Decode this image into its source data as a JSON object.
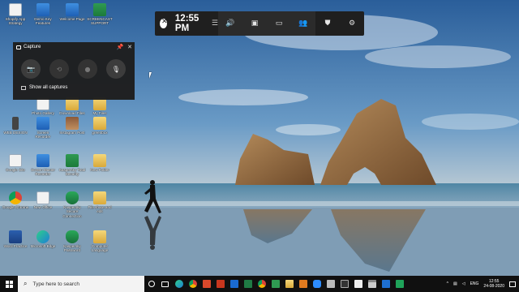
{
  "desktop": {
    "icons": [
      {
        "label": "Shopify App Strategy",
        "glyph": "g-doc"
      },
      {
        "label": "Demo Key Features",
        "glyph": "g-blue"
      },
      {
        "label": "Welcome Page",
        "glyph": "g-blue"
      },
      {
        "label": "SCREENCAST SUPPORT",
        "glyph": "g-green"
      },
      {
        "label": "Photo Gallery",
        "glyph": "g-doc"
      },
      {
        "label": "Download Files",
        "glyph": "g-folder"
      },
      {
        "label": "My Files",
        "glyph": "g-folder"
      },
      {
        "label": "WEB DESIGN",
        "glyph": "g-phone"
      },
      {
        "label": "Screen Recorder",
        "glyph": "g-blue"
      },
      {
        "label": "Instagram Post",
        "glyph": "g-photo"
      },
      {
        "label": "greenbox",
        "glyph": "g-folder"
      },
      {
        "label": "Google Site",
        "glyph": "g-doc"
      },
      {
        "label": "Screen Master Recorder",
        "glyph": "g-blue"
      },
      {
        "label": "Kaspersky Total Security",
        "glyph": "g-green"
      },
      {
        "label": "New Folder",
        "glyph": "g-folder"
      },
      {
        "label": "Google Chrome",
        "glyph": "g-chrome"
      },
      {
        "label": "New Office",
        "glyph": "g-doc"
      },
      {
        "label": "Kaspersky Secure Connection",
        "glyph": "g-shield"
      },
      {
        "label": "File share and edit",
        "glyph": "g-folder"
      },
      {
        "label": "Word Practice",
        "glyph": "g-word"
      },
      {
        "label": "Microsoft Edge",
        "glyph": "g-edge"
      },
      {
        "label": "Kaspersky Password",
        "glyph": "g-shield"
      },
      {
        "label": "Computer Language",
        "glyph": "g-folder"
      }
    ]
  },
  "gamebar": {
    "time": "12:55 PM",
    "buttons": [
      {
        "name": "audio",
        "glyph": "🔊"
      },
      {
        "name": "capture",
        "glyph": "▣"
      },
      {
        "name": "performance",
        "glyph": "▭"
      },
      {
        "name": "social",
        "glyph": "👥"
      }
    ],
    "right_buttons": [
      {
        "name": "shield",
        "glyph": "⛊"
      },
      {
        "name": "settings",
        "glyph": "⚙"
      }
    ]
  },
  "capture": {
    "title": "Capture",
    "show_all": "Show all captures"
  },
  "taskbar": {
    "search_placeholder": "Type here to search",
    "language": "ENG",
    "time": "12:55",
    "date": "24-08-2020"
  },
  "colors": {
    "gamebar_bg": "#1f1f1f",
    "taskbar_bg": "#101010"
  }
}
